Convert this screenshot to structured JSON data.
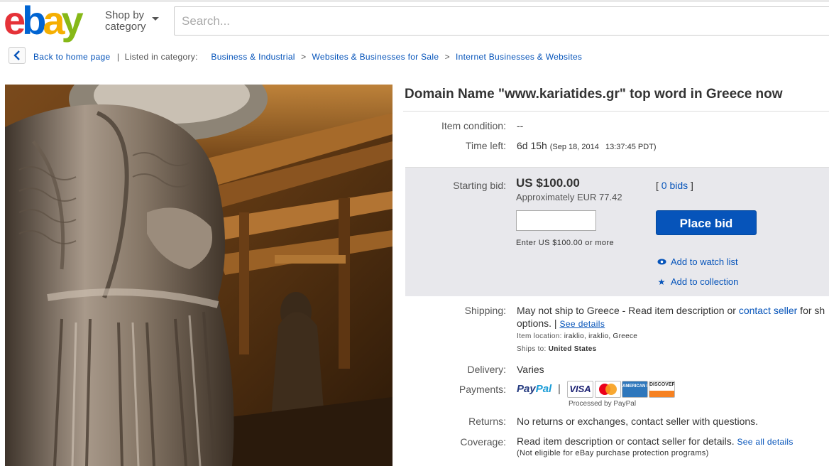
{
  "header": {
    "logo_letters": [
      "e",
      "b",
      "a",
      "y"
    ],
    "shop_by_line1": "Shop by",
    "shop_by_line2": "category",
    "search_placeholder": "Search..."
  },
  "breadcrumb": {
    "back_label": "Back to home page",
    "separator": "|",
    "listed_in": "Listed in category:",
    "items": [
      "Business & Industrial",
      "Websites & Businesses for Sale",
      "Internet Businesses & Websites"
    ],
    "gt": ">"
  },
  "item": {
    "title": "Domain Name \"www.kariatides.gr\" top word in Greece now",
    "condition_label": "Item condition:",
    "condition_value": "--",
    "time_left_label": "Time left:",
    "time_left_value": "6d 15h",
    "time_left_detail": "(Sep 18, 2014   13:37:45 PDT)"
  },
  "bid": {
    "starting_label": "Starting bid:",
    "price": "US $100.00",
    "approx": "Approximately EUR 77.42",
    "bids_open": "[",
    "bids_link": "0 bids",
    "bids_close": "]",
    "enter_hint": "Enter US $100.00 or more",
    "place_bid": "Place bid",
    "watch": "Add to watch list",
    "collection": "Add to collection"
  },
  "shipping": {
    "label": "Shipping:",
    "text1": "May not ship to Greece - Read item description or ",
    "contact": "contact seller",
    "text2": " for sh",
    "text3": "options. |",
    "see_details": "See details",
    "location_label": "Item location:",
    "location": "iraklio, iraklio, Greece",
    "ships_to_label": "Ships to:",
    "ships_to": "United States"
  },
  "delivery": {
    "label": "Delivery:",
    "value": "Varies"
  },
  "payments": {
    "label": "Payments:",
    "paypal1": "Pay",
    "paypal2": "Pal",
    "pipe": "|",
    "visa": "VISA",
    "amex": "AMERICAN EXPRESS",
    "discover": "DISCOVER",
    "processed": "Processed by PayPal"
  },
  "returns": {
    "label": "Returns:",
    "value": "No returns or exchanges, contact seller with questions."
  },
  "coverage": {
    "label": "Coverage:",
    "value": "Read item description or contact seller for details.",
    "see_all": "See all details",
    "note": "(Not eligible for eBay purchase protection programs)"
  },
  "colors": {
    "ebay_red": "#e53238",
    "ebay_blue": "#0064d2",
    "ebay_yellow": "#f5af02",
    "ebay_green": "#86b817",
    "link": "#0654ba",
    "bid_panel": "#e8e8ec"
  }
}
